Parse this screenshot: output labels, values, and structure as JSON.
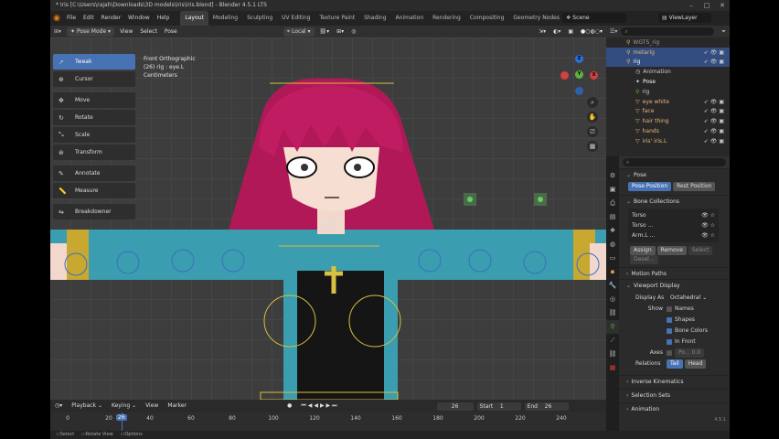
{
  "title": "* Iris [C:\\Users\\rajah\\Downloads\\3D models\\iris\\iris.blend] - Blender 4.5.1 LTS",
  "menus": [
    "File",
    "Edit",
    "Render",
    "Window",
    "Help"
  ],
  "workspaces": [
    "Layout",
    "Modeling",
    "Sculpting",
    "UV Editing",
    "Texture Paint",
    "Shading",
    "Animation",
    "Rendering",
    "Compositing",
    "Geometry Nodes",
    "Sc"
  ],
  "scene": "Scene",
  "view_layer": "ViewLayer",
  "viewport_header": {
    "mode": "Pose Mode",
    "menus": [
      "View",
      "Select",
      "Pose"
    ],
    "orientation": "Local",
    "pose_options": "Pose Options"
  },
  "tools": [
    "Tweak",
    "Cursor",
    "Move",
    "Rotate",
    "Scale",
    "Transform",
    "Annotate",
    "Measure",
    "Breakdowner"
  ],
  "viewport_info": [
    "Front Orthographic",
    "(26) rig : eye.L",
    "Centimeters"
  ],
  "gizmo": {
    "z": "Z",
    "y": "Y",
    "x": "X"
  },
  "outliner": {
    "search_placeholder": "",
    "rows": [
      {
        "name": "WGTS_rig",
        "selected": false
      },
      {
        "name": "metarig",
        "selected": true
      },
      {
        "name": "rig",
        "selected": true
      },
      {
        "name": "Animation",
        "selected": false
      },
      {
        "name": "Pose",
        "selected": false
      },
      {
        "name": "rig",
        "selected": false
      },
      {
        "name": "eye white",
        "selected": false
      },
      {
        "name": "face",
        "selected": false
      },
      {
        "name": "hair thing",
        "selected": false
      },
      {
        "name": "hands",
        "selected": false
      },
      {
        "name": "iris' iris.L",
        "selected": false
      }
    ]
  },
  "properties": {
    "section_pose": "Pose",
    "pose_position": "Pose Position",
    "rest_position": "Rest Position",
    "bone_collections": "Bone Collections",
    "collections": [
      "Torso",
      "Torso ...",
      "Arm.L ..."
    ],
    "assign": "Assign",
    "remove": "Remove",
    "select": "Select",
    "deselect": "Desel...",
    "motion_paths": "Motion Paths",
    "viewport_display": "Viewport Display",
    "display_as_label": "Display As",
    "display_as": "Octahedral",
    "show_label": "Show",
    "names": "Names",
    "shapes": "Shapes",
    "bone_colors": "Bone Colors",
    "in_front": "In Front",
    "axes": "Axes",
    "axes_pos": "Po... 0.0",
    "relations_label": "Relations",
    "tail": "Tail",
    "head": "Head",
    "inverse_kinematics": "Inverse Kinematics",
    "selection_sets": "Selection Sets",
    "animation": "Animation",
    "version": "4.5.1"
  },
  "timeline": {
    "menus": [
      "Playback",
      "Keying",
      "View",
      "Marker"
    ],
    "current_frame": "26",
    "start_label": "Start",
    "start": "1",
    "end_label": "End",
    "end": "26",
    "ticks": [
      "0",
      "20",
      "40",
      "60",
      "80",
      "100",
      "120",
      "140",
      "160",
      "180",
      "200",
      "220",
      "240"
    ]
  },
  "statusbar": [
    "Select",
    "Rotate View",
    "Options"
  ],
  "colors": {
    "accent": "#4772b3",
    "hair": "#b01858",
    "outfit": "#3a9db0",
    "bone_gold": "#d8c040"
  }
}
